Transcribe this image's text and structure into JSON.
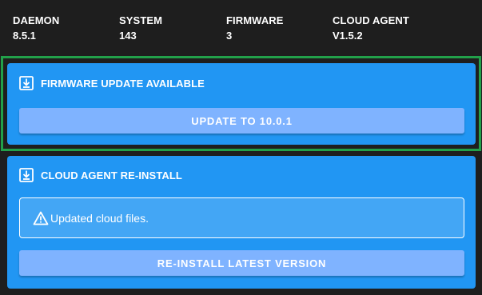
{
  "versions": [
    {
      "label": "DAEMON",
      "value": "8.5.1"
    },
    {
      "label": "SYSTEM",
      "value": "143"
    },
    {
      "label": "FIRMWARE",
      "value": "3"
    },
    {
      "label": "CLOUD AGENT",
      "value": "V1.5.2"
    }
  ],
  "firmware_card": {
    "title": "FIRMWARE UPDATE AVAILABLE",
    "icon": "download-icon",
    "button_label": "UPDATE TO 10.0.1"
  },
  "cloud_agent_card": {
    "title": "CLOUD AGENT RE-INSTALL",
    "icon": "download-icon",
    "alert_icon": "warning-icon",
    "alert_text": "Updated cloud files.",
    "button_label": "RE-INSTALL LATEST VERSION"
  },
  "colors": {
    "background": "#1e1e1e",
    "card": "#2196f3",
    "button": "#7fb3ff",
    "highlight": "#22a04a"
  }
}
